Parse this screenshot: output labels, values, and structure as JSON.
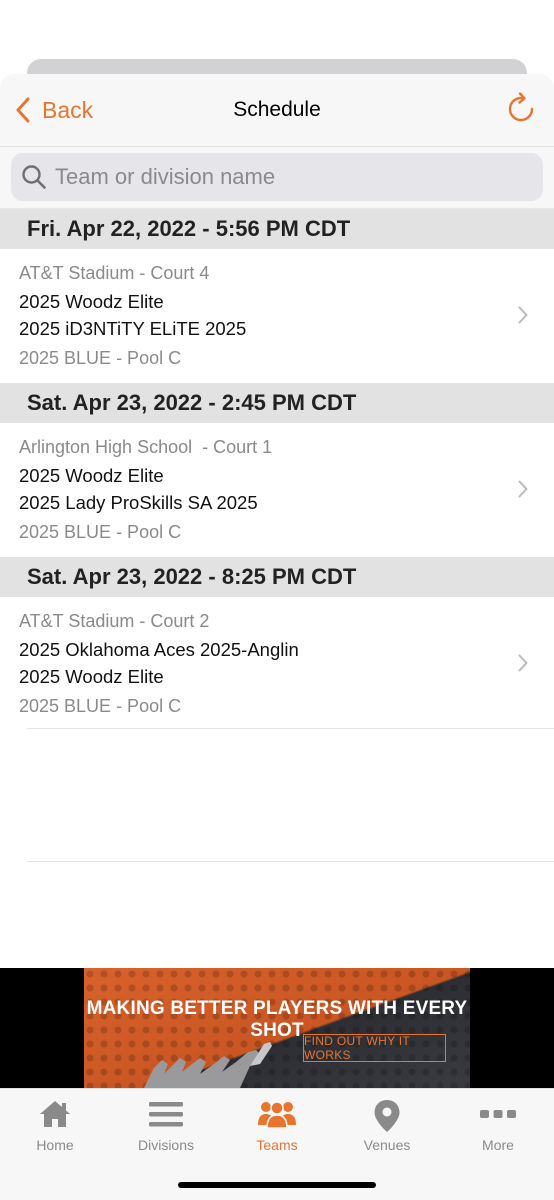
{
  "nav": {
    "back_label": "Back",
    "title": "Schedule"
  },
  "search": {
    "placeholder": "Team or division name"
  },
  "schedule": [
    {
      "date_header": "Fri. Apr 22, 2022 - 5:56 PM CDT",
      "venue": "AT&T Stadium - Court 4",
      "team1": "2025 Woodz Elite",
      "team2": "2025 iD3NTiTY ELiTE 2025",
      "pool": "2025 BLUE - Pool C"
    },
    {
      "date_header": "Sat. Apr 23, 2022 - 2:45 PM CDT",
      "venue": "Arlington High School  - Court 1",
      "team1": "2025 Woodz Elite",
      "team2": "2025 Lady ProSkills SA 2025",
      "pool": "2025 BLUE - Pool C"
    },
    {
      "date_header": "Sat. Apr 23, 2022 - 8:25 PM CDT",
      "venue": "AT&T Stadium - Court 2",
      "team1": "2025 Oklahoma Aces 2025-Anglin",
      "team2": "2025 Woodz Elite",
      "pool": "2025 BLUE - Pool C"
    }
  ],
  "ad": {
    "headline": "MAKING BETTER PLAYERS WITH EVERY SHOT",
    "cta": "FIND OUT WHY IT WORKS"
  },
  "tabs": [
    {
      "label": "Home",
      "icon": "home-icon"
    },
    {
      "label": "Divisions",
      "icon": "list-icon"
    },
    {
      "label": "Teams",
      "icon": "people-icon",
      "active": true
    },
    {
      "label": "Venues",
      "icon": "location-pin-icon"
    },
    {
      "label": "More",
      "icon": "more-dots-icon"
    }
  ],
  "colors": {
    "accent": "#e8742e",
    "inactive": "#8a8a8a",
    "section_bg": "#e2e2e2"
  }
}
